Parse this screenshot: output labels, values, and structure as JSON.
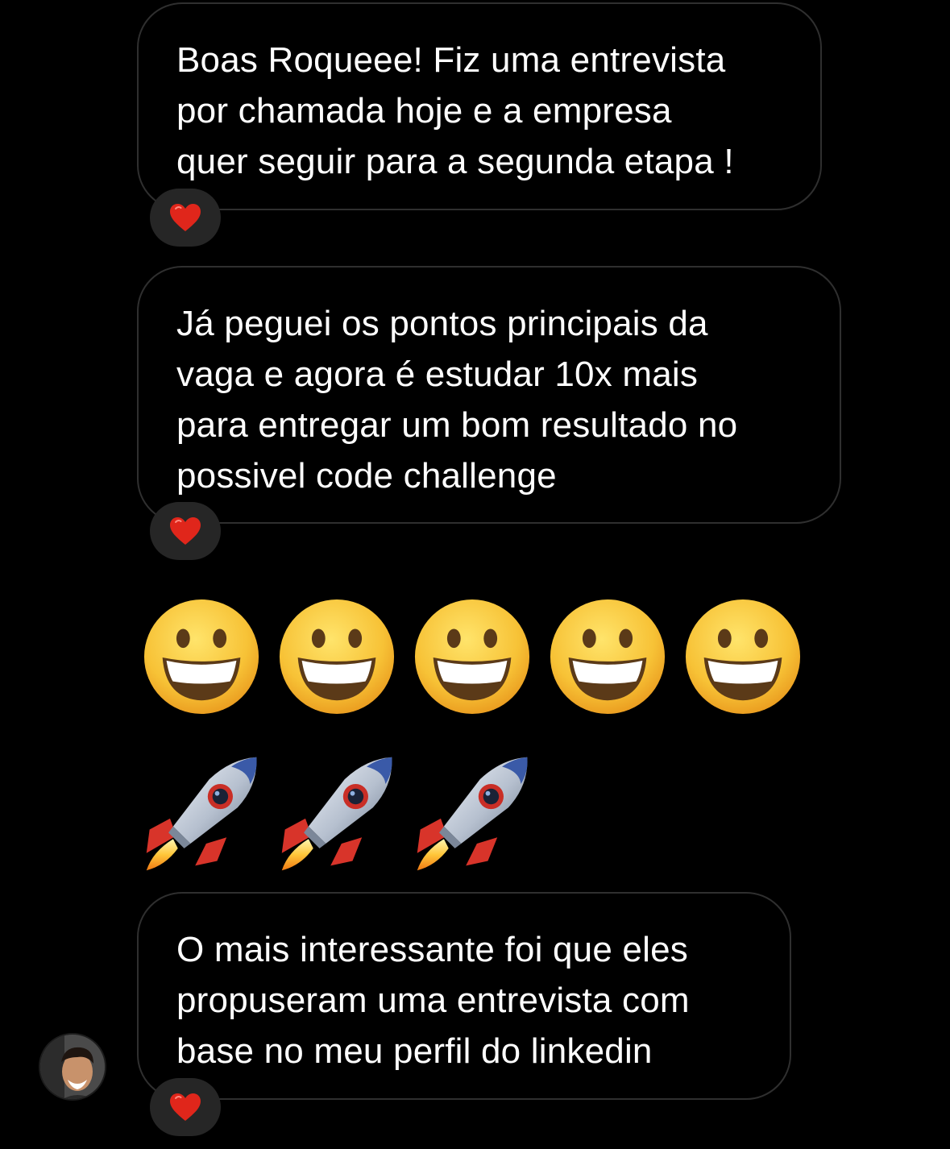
{
  "messages": [
    {
      "text": "Boas Roqueee! Fiz uma entrevista\npor chamada hoje e a empresa\nquer seguir para a segunda etapa !",
      "reaction": "heart-icon"
    },
    {
      "text": "Já peguei os pontos principais da\nvaga e agora é estudar 10x mais\npara entregar um bom resultado no\npossivel code challenge",
      "reaction": "heart-icon"
    },
    {
      "text": "O mais interessante foi que eles\npropuseram uma entrevista com\nbase no meu perfil do linkedin",
      "reaction": "heart-icon"
    }
  ],
  "emoji_messages": [
    {
      "icon": "grinning-face-icon",
      "count": 5
    },
    {
      "icon": "rocket-icon",
      "count": 3
    }
  ],
  "sender": {
    "avatar": "avatar"
  },
  "colors": {
    "background": "#000000",
    "bubble_border": "#2f2f2f",
    "reaction_pill": "#262626",
    "heart": "#e0261b"
  }
}
